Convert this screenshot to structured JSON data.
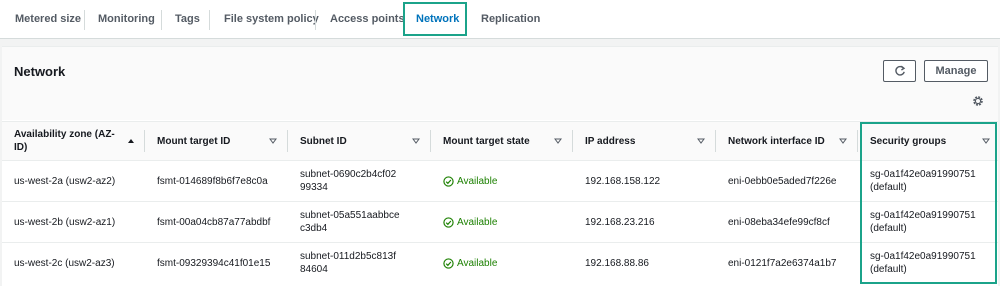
{
  "tabs": [
    {
      "label": "Metered size"
    },
    {
      "label": "Monitoring"
    },
    {
      "label": "Tags"
    },
    {
      "label": "File system policy"
    },
    {
      "label": "Access points"
    },
    {
      "label": "Network",
      "active": true
    },
    {
      "label": "Replication"
    }
  ],
  "panel": {
    "title": "Network",
    "manage_label": "Manage",
    "refresh_icon": "refresh-icon",
    "settings_icon": "gear-icon"
  },
  "table": {
    "columns": [
      {
        "label": "Availability zone (AZ-ID)",
        "sort": "ascending"
      },
      {
        "label": "Mount target ID",
        "sort": "none"
      },
      {
        "label": "Subnet ID",
        "sort": "none"
      },
      {
        "label": "Mount target state",
        "sort": "none"
      },
      {
        "label": "IP address",
        "sort": "none"
      },
      {
        "label": "Network interface ID",
        "sort": "none"
      },
      {
        "label": "Security groups",
        "sort": "none"
      }
    ],
    "rows": [
      {
        "az": "us-west-2a (usw2-az2)",
        "mount_target": "fsmt-014689f8b6f7e8c0a",
        "subnet": "subnet-0690c2b4cf0299334",
        "state": "Available",
        "ip": "192.168.158.122",
        "eni": "eni-0ebb0e5aded7f226e",
        "sg": "sg-0a1f42e0a91990751 (default)"
      },
      {
        "az": "us-west-2b (usw2-az1)",
        "mount_target": "fsmt-00a04cb87a77abdbf",
        "subnet": "subnet-05a551aabbcec3db4",
        "state": "Available",
        "ip": "192.168.23.216",
        "eni": "eni-08eba34efe99cf8cf",
        "sg": "sg-0a1f42e0a91990751 (default)"
      },
      {
        "az": "us-west-2c (usw2-az3)",
        "mount_target": "fsmt-09329394c41f01e15",
        "subnet": "subnet-011d2b5c813f84604",
        "state": "Available",
        "ip": "192.168.88.86",
        "eni": "eni-0121f7a2e6374a1b7",
        "sg": "sg-0a1f42e0a91990751 (default)"
      }
    ]
  },
  "colors": {
    "accent_blue": "#0073bb",
    "status_green": "#1d8102",
    "highlight_teal": "#1ba38a"
  }
}
